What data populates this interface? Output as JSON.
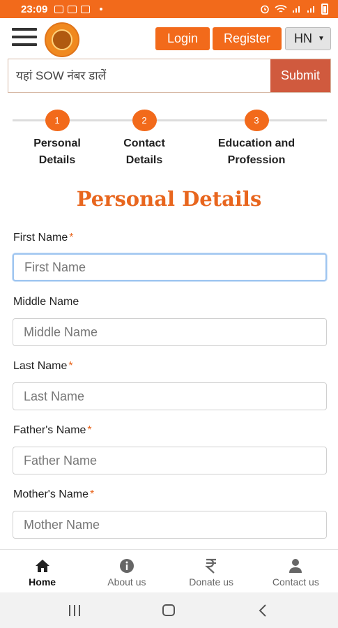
{
  "status_bar": {
    "time": "23:09"
  },
  "header": {
    "login_label": "Login",
    "register_label": "Register",
    "language": "HN"
  },
  "sow": {
    "placeholder": "यहां SOW नंबर डालें",
    "submit_label": "Submit"
  },
  "steps": [
    {
      "number": "1",
      "label": "Personal Details"
    },
    {
      "number": "2",
      "label": "Contact Details"
    },
    {
      "number": "3",
      "label": "Education and Profession"
    }
  ],
  "form": {
    "title": "Personal Details",
    "fields": [
      {
        "label": "First Name",
        "required": "*",
        "placeholder": "First Name"
      },
      {
        "label": "Middle Name",
        "required": "",
        "placeholder": "Middle Name"
      },
      {
        "label": "Last Name",
        "required": "*",
        "placeholder": "Last Name"
      },
      {
        "label": "Father's Name",
        "required": "*",
        "placeholder": "Father Name"
      },
      {
        "label": "Mother's Name",
        "required": "*",
        "placeholder": "Mother Name"
      }
    ]
  },
  "bottom_nav": [
    {
      "label": "Home",
      "icon": "home-icon"
    },
    {
      "label": "About us",
      "icon": "info-icon"
    },
    {
      "label": "Donate us",
      "icon": "rupee-icon"
    },
    {
      "label": "Contact us",
      "icon": "user-icon"
    }
  ],
  "colors": {
    "accent": "#f26a1b",
    "submit": "#d05a3e",
    "title": "#e8661e"
  }
}
